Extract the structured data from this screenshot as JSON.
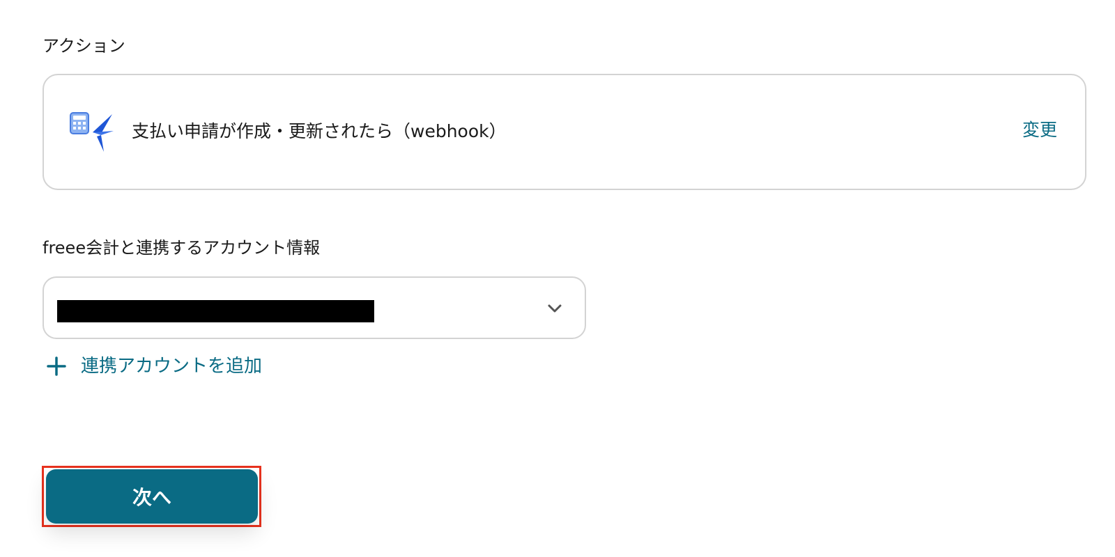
{
  "action_section": {
    "label": "アクション",
    "card": {
      "icon": "freee-accounting-app-icon",
      "title": "支払い申請が作成・更新されたら（webhook）",
      "change_label": "変更"
    }
  },
  "account_section": {
    "label": "freee会計と連携するアカウント情報",
    "select": {
      "value_redacted": true,
      "chevron_icon": "chevron-down-icon"
    },
    "add_account": {
      "icon": "plus-icon",
      "label": "連携アカウントを追加"
    }
  },
  "footer": {
    "next_label": "次へ"
  },
  "colors": {
    "accent": "#0a6b84",
    "highlight_border": "#e8321e",
    "card_border": "#d3d3d3",
    "icon_blue": "#4a7de0"
  }
}
